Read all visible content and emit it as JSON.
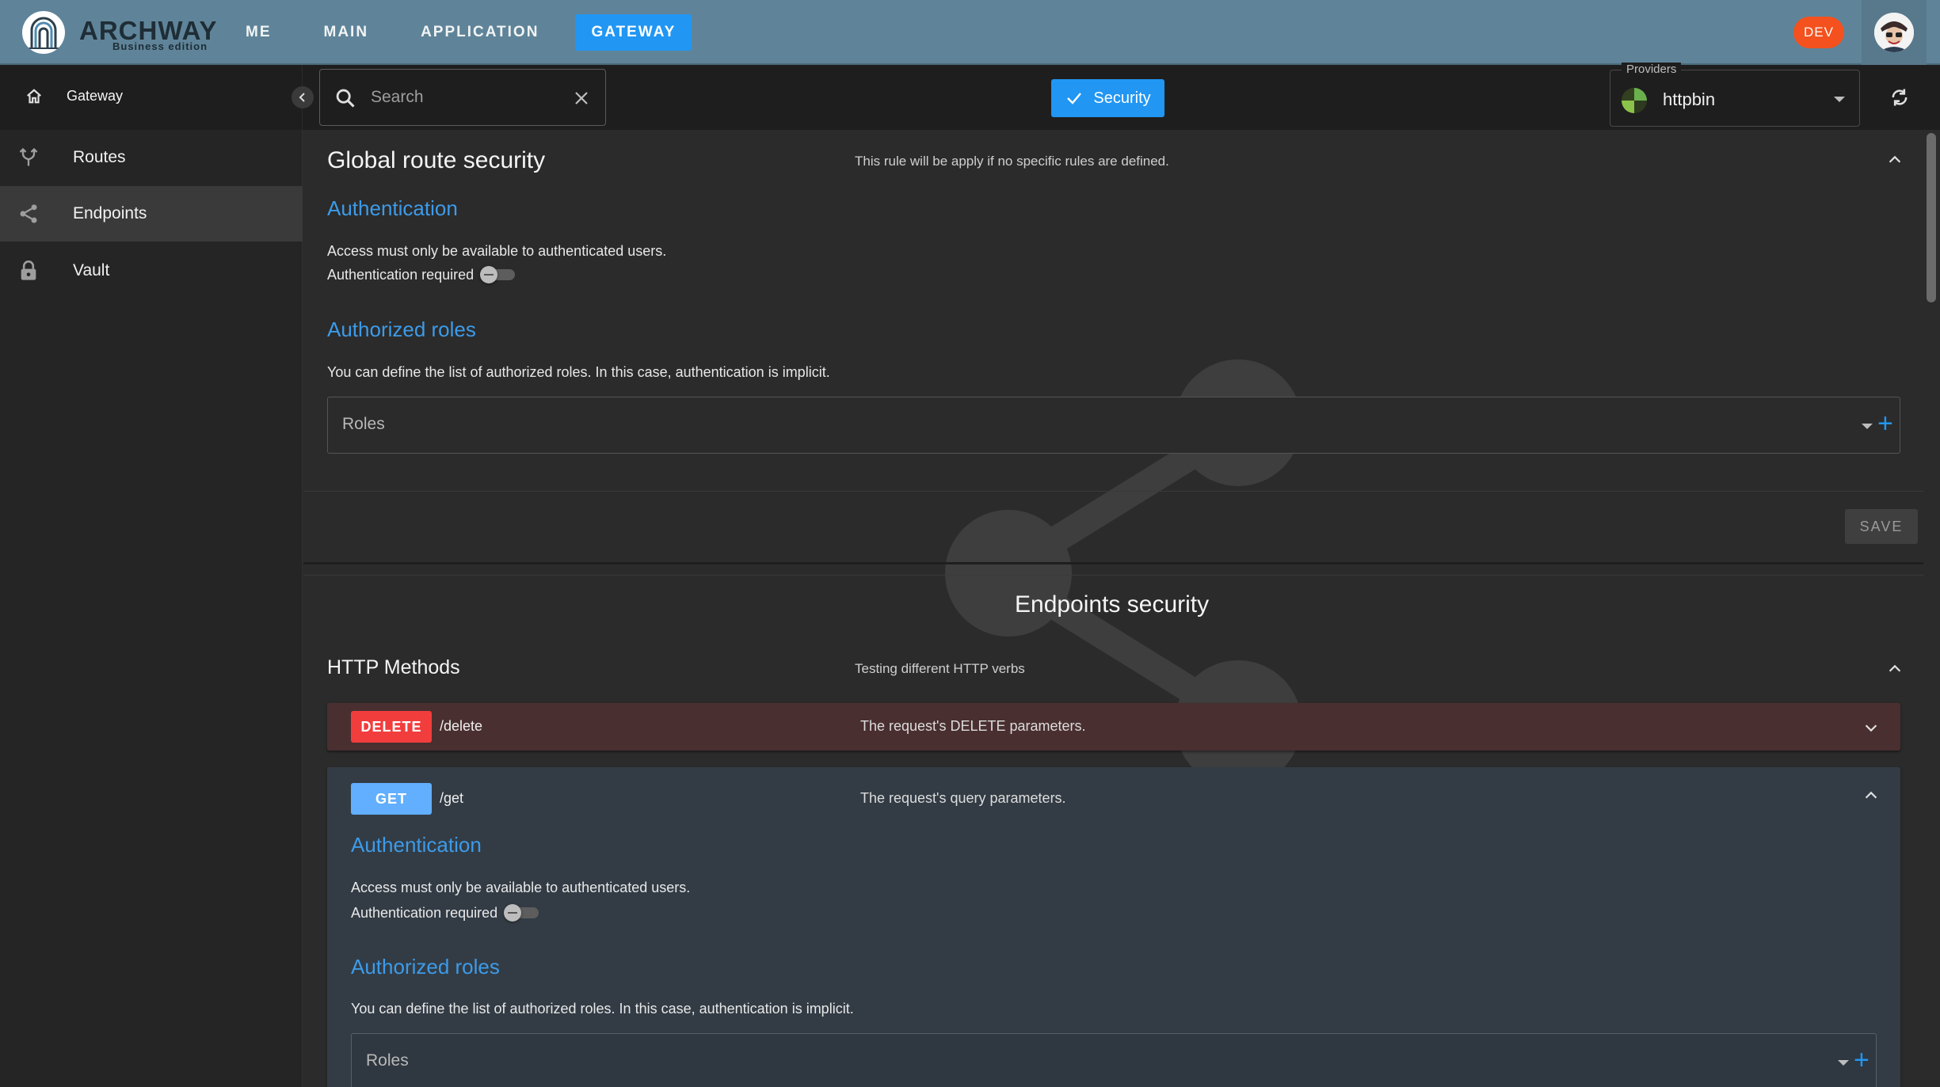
{
  "app": {
    "name": "ARCHWAY",
    "edition": "Business edition",
    "env_badge": "DEV",
    "accent_color": "#2196f3",
    "appbar_color": "#5f8499"
  },
  "topnav": {
    "items": [
      {
        "label": "ME",
        "active": false
      },
      {
        "label": "MAIN",
        "active": false
      },
      {
        "label": "APPLICATION",
        "active": false
      },
      {
        "label": "GATEWAY",
        "active": true
      }
    ]
  },
  "toolbar": {
    "sidebar_title": "Gateway",
    "search_placeholder": "Search",
    "security_label": "Security",
    "providers_label": "Providers",
    "provider_value": "httpbin"
  },
  "sidebar": {
    "items": [
      {
        "label": "Routes",
        "icon": "fork-icon",
        "active": false
      },
      {
        "label": "Endpoints",
        "icon": "share-icon",
        "active": true
      },
      {
        "label": "Vault",
        "icon": "lock-icon",
        "active": false
      }
    ]
  },
  "global": {
    "title": "Global route security",
    "hint": "This rule will be apply if no specific rules are defined.",
    "auth_heading": "Authentication",
    "auth_text": "Access must only be available to authenticated users.",
    "auth_toggle_label": "Authentication required",
    "roles_heading": "Authorized roles",
    "roles_text": "You can define the list of authorized roles. In this case, authentication is implicit.",
    "roles_field_label": "Roles",
    "save_label": "SAVE"
  },
  "endpoints": {
    "title": "Endpoints security",
    "group_title": "HTTP Methods",
    "group_hint": "Testing different HTTP verbs",
    "methods": [
      {
        "method": "DELETE",
        "path": "/delete",
        "description": "The request's DELETE parameters.",
        "color": "#f23d3d"
      },
      {
        "method": "GET",
        "path": "/get",
        "description": "The request's query parameters.",
        "color": "#61affe",
        "auth_heading": "Authentication",
        "auth_text": "Access must only be available to authenticated users.",
        "auth_toggle_label": "Authentication required",
        "roles_heading": "Authorized roles",
        "roles_text": "You can define the list of authorized roles. In this case, authentication is implicit.",
        "roles_field_label": "Roles"
      }
    ]
  }
}
